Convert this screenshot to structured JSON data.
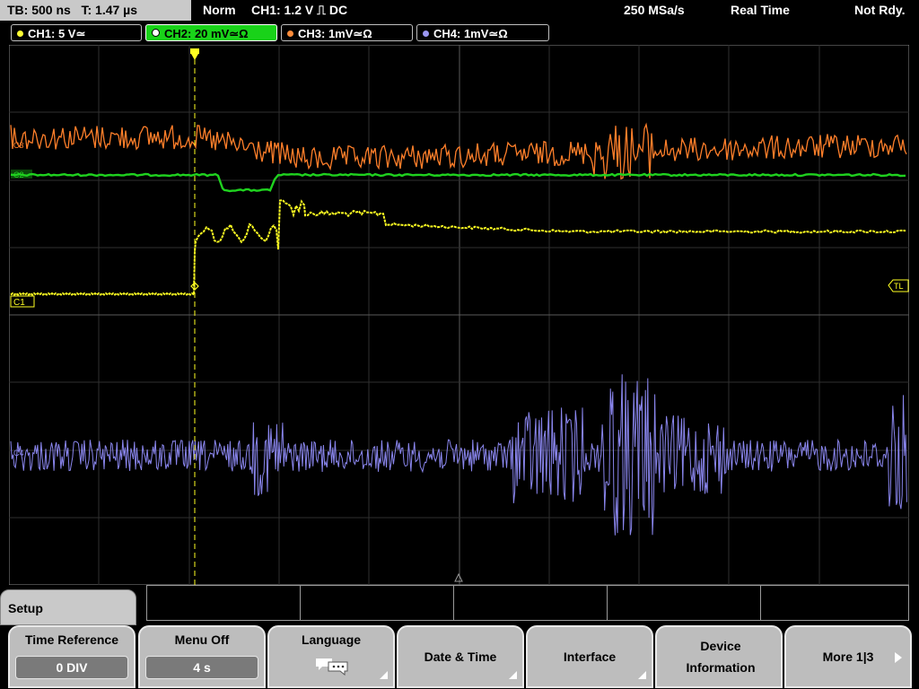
{
  "status": {
    "timebase": "TB: 500 ns",
    "trigger_time": "T: 1.47 µs",
    "mode": "Norm",
    "trigger_info": "CH1: 1.2 V ⎍ DC",
    "sample_rate": "250 MSa/s",
    "acq_mode": "Real Time",
    "state": "Not Rdy."
  },
  "channels": [
    {
      "label": "CH1: 5 V≃",
      "color": "#ffff33",
      "active": false
    },
    {
      "label": "CH2: 20 mV≃Ω",
      "color": "#20d020",
      "active": true
    },
    {
      "label": "CH3: 1mV≃Ω",
      "color": "#ff8c3a",
      "active": false
    },
    {
      "label": "CH4: 1mV≃Ω",
      "color": "#9a96f0",
      "active": false
    }
  ],
  "markers": {
    "ch1": "C1",
    "ch2": "C2",
    "ch3": "C3",
    "ch4": "C4",
    "trigger_level": "TL"
  },
  "menu": {
    "title": "Setup",
    "softkeys": [
      {
        "label": "Time Reference",
        "value": "0 DIV"
      },
      {
        "label": "Menu Off",
        "value": "4 s"
      },
      {
        "label": "Language",
        "icon": "speech-bubble-icon",
        "submenu": true
      },
      {
        "label": "Date & Time",
        "submenu": true
      },
      {
        "label": "Interface",
        "submenu": true
      },
      {
        "label": "Device Information"
      },
      {
        "label": "More 1|3",
        "icon": "arrow-right-icon"
      }
    ]
  }
}
